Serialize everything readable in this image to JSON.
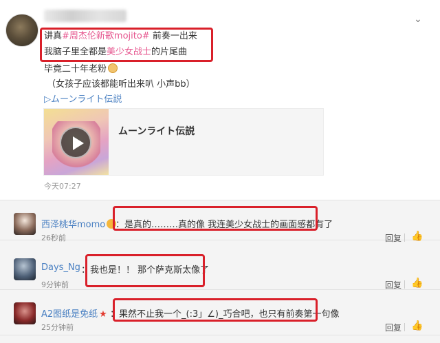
{
  "post": {
    "line1": {
      "prefix": "讲真",
      "topic": "#周杰伦新歌mojito#",
      "suffix": " 前奏一出来"
    },
    "line2": {
      "prefix": "我脑子里全都是",
      "highlight": "美少女战士",
      "suffix": "的片尾曲"
    },
    "line3": "毕竟二十年老粉",
    "line4": "（女孩子应该都能听出来叭 小声bb）",
    "link": "▷ムーンライト伝説",
    "card_title": "ムーンライト伝説",
    "time": "今天07:27"
  },
  "comments": [
    {
      "name": "西泽桃华momo",
      "text": "：是真的………真的像 我连美少女战士的画面感都有了",
      "time": "26秒前",
      "reply": "回复"
    },
    {
      "name": "Days_Ng",
      "text": "：我也是！！ 那个萨克斯太像了",
      "time": "9分钟前",
      "reply": "回复"
    },
    {
      "name": "A2图纸是免纸",
      "text": "：果然不止我一个_(:3」∠)_巧合吧，也只有前奏第一句像",
      "time": "25分钟前",
      "reply": "回复"
    }
  ]
}
